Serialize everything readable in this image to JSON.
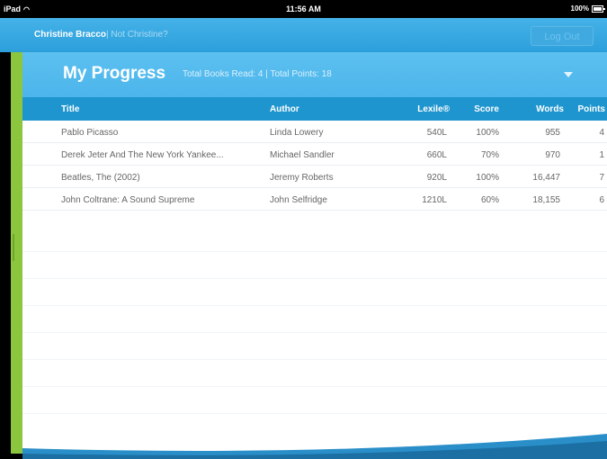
{
  "statusbar": {
    "device": "iPad",
    "time": "11:56 AM",
    "battery": "100%"
  },
  "header": {
    "user_name": "Christine Bracco",
    "not_user": "| Not Christine?",
    "logout_label": "Log Out"
  },
  "progress": {
    "title": "My Progress",
    "stats": "Total Books Read: 4  |  Total Points: 18"
  },
  "table": {
    "columns": [
      "Title",
      "Author",
      "Lexile®",
      "Score",
      "Words",
      "Points"
    ],
    "rows": [
      {
        "title": "Pablo Picasso",
        "author": "Linda Lowery",
        "lexile": "540L",
        "score": "100%",
        "words": "955",
        "points": "4"
      },
      {
        "title": "Derek Jeter And The New York Yankee...",
        "author": "Michael Sandler",
        "lexile": "660L",
        "score": "70%",
        "words": "970",
        "points": "1"
      },
      {
        "title": "Beatles, The (2002)",
        "author": "Jeremy Roberts",
        "lexile": "920L",
        "score": "100%",
        "words": "16,447",
        "points": "7"
      },
      {
        "title": "John Coltrane: A Sound Supreme",
        "author": "John Selfridge",
        "lexile": "1210L",
        "score": "60%",
        "words": "18,155",
        "points": "6"
      }
    ]
  },
  "colors": {
    "header_blue": "#2c9fdb",
    "title_blue": "#4cb5eb",
    "table_header_blue": "#1f95cf",
    "accent_green": "#8cc63f"
  }
}
